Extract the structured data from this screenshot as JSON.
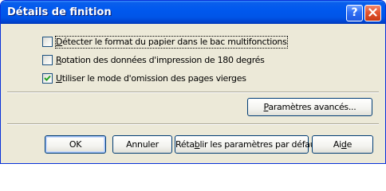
{
  "window": {
    "title": "Détails de finition",
    "help_glyph": "?",
    "help_icon": "question-mark-icon",
    "close_icon": "close-x-icon",
    "colors": {
      "titlebar": "#0058ee",
      "face": "#ece9d8",
      "close": "#e45530"
    }
  },
  "options": [
    {
      "label": "Détecter le format du papier dans le bac multifonctions",
      "checked": false
    },
    {
      "label": "Rotation des données d'impression de 180 degrés",
      "checked": false
    },
    {
      "label": "Utiliser le mode d'omission des pages vierges",
      "checked": true
    }
  ],
  "advanced_button": {
    "label": "Paramètres avancés..."
  },
  "footer": {
    "ok_label": "OK",
    "cancel_label": "Annuler",
    "restore_label": "Rétablir les paramètres par défaut",
    "help_label": "Aide"
  }
}
